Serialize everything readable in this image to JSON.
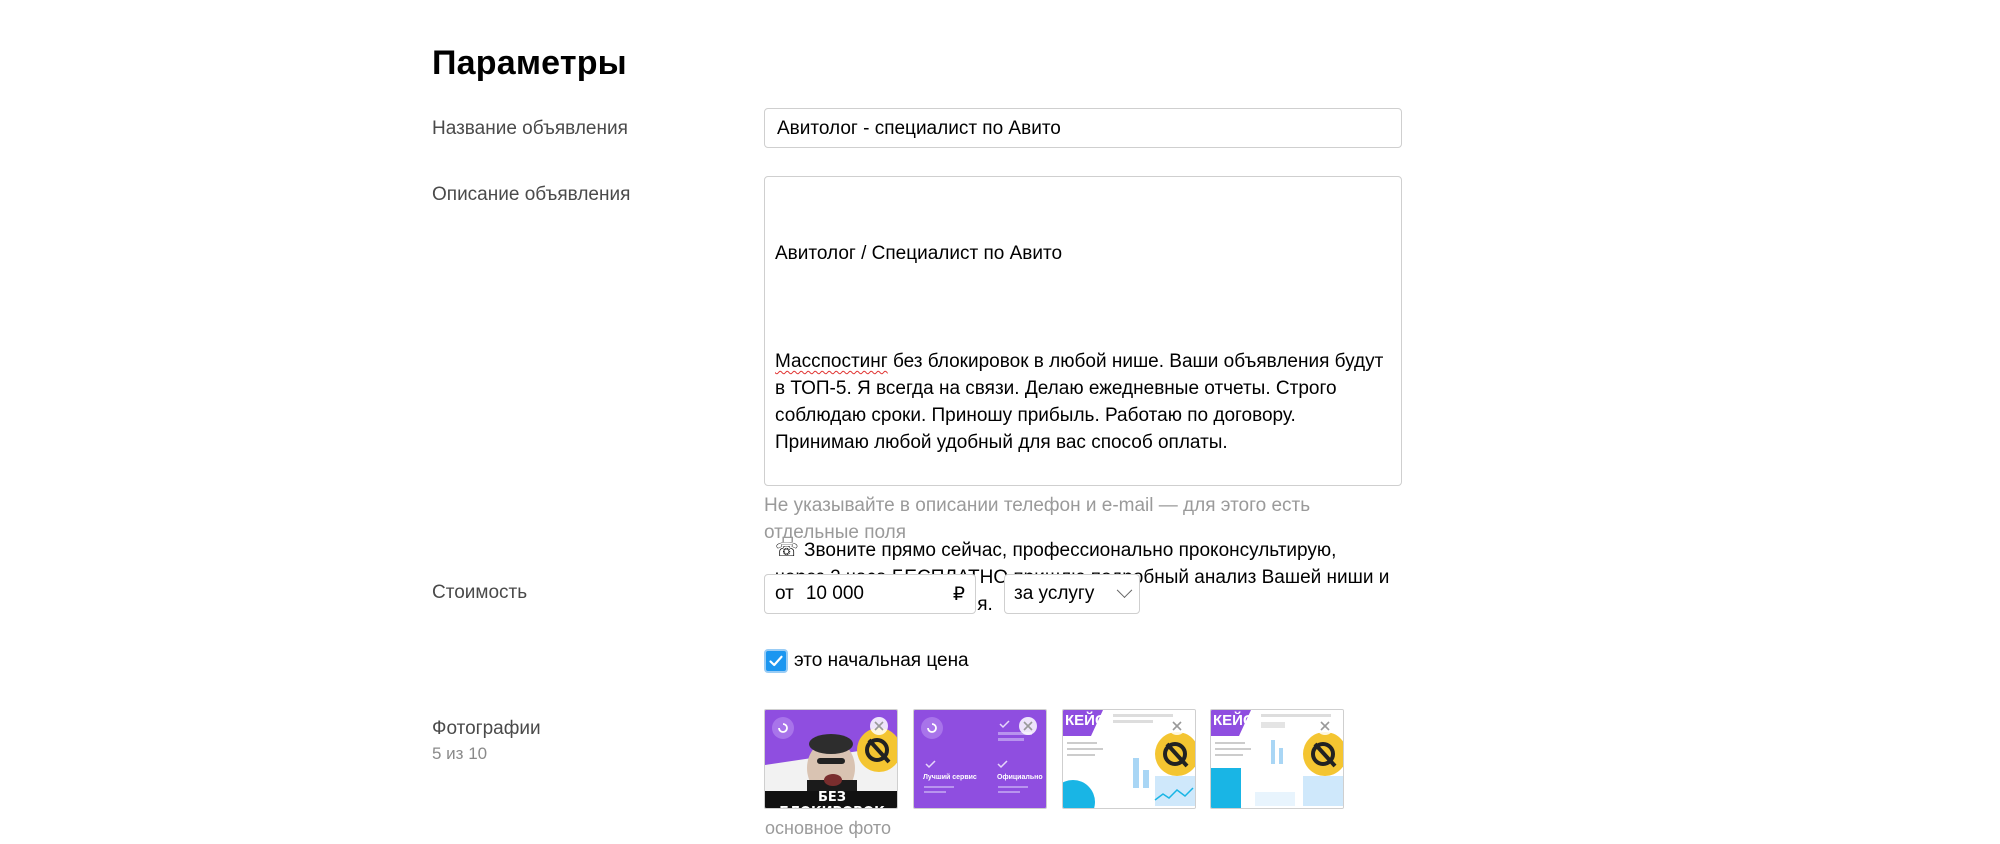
{
  "page_title": "Параметры",
  "name_field": {
    "label": "Название объявления",
    "value": "Авитолог - специалист по Авито"
  },
  "description_field": {
    "label": "Описание объявления",
    "line1": "Авитолог / Специалист по Авито",
    "p2_misspelled": "Масспостинг",
    "p2_rest": " без блокировок в любой нише. Ваши объявления будут в ТОП-5. Я всегда на связи. Делаю ежедневные отчеты. Строго соблюдаю сроки. Приношу прибыль. Работаю по договору. Принимаю любой удобный для вас способ оплаты.",
    "p3": "☏ Звоните прямо сейчас, профессионально проконсультирую, через 2 часа БЕСПЛАТНО пришлю подробный анализ Вашей ниши и стратегию продвижения.",
    "hint": "Не указывайте в описании телефон и e-mail — для этого есть отдельные поля"
  },
  "price_field": {
    "label": "Стоимость",
    "prefix": "от",
    "value": "10 000",
    "currency": "₽",
    "unit": "за услугу",
    "initial_price_checkbox_label": "это начальная цена",
    "initial_price_checked": true
  },
  "photos_field": {
    "label": "Фотографии",
    "count": "5 из 10",
    "main_photo_caption": "основное фото",
    "photo1_caption": "БЕЗ БЛОКИРОВОК",
    "photo2_text1": "Лучший сервис",
    "photo2_text2": "Официально",
    "photo3_text": "КЕЙС",
    "photo4_text": "КЕЙС"
  },
  "colors": {
    "accent_blue": "#1b96f0",
    "brand_purple": "#8f4ee0",
    "brand_yellow": "#f4c531",
    "brand_cyan": "#19b5e5"
  }
}
